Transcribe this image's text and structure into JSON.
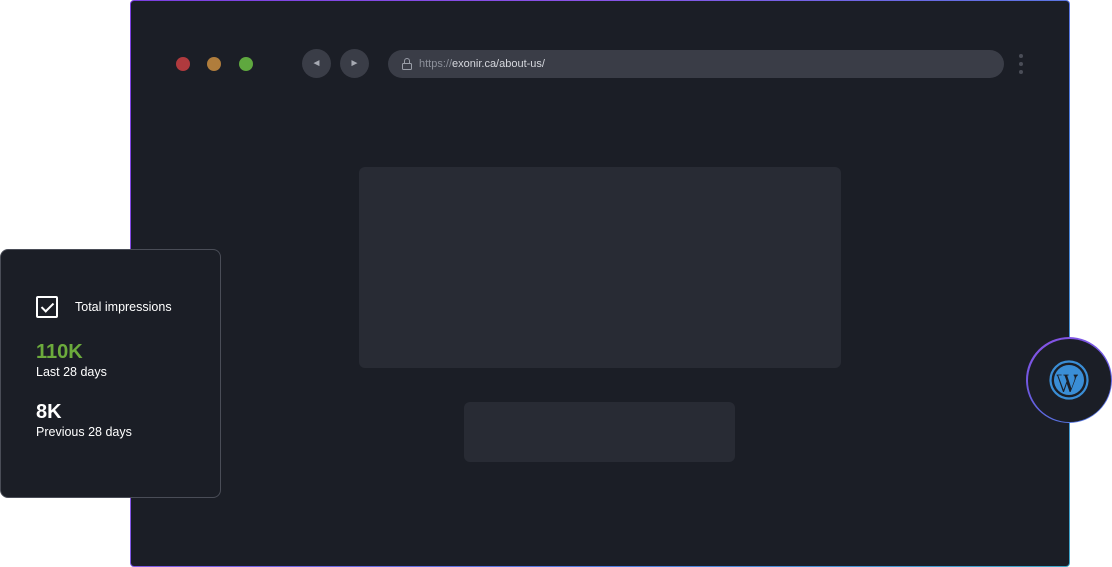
{
  "browser": {
    "window_controls": [
      "close",
      "minimize",
      "maximize"
    ],
    "nav": {
      "back_icon": "back-arrow-icon",
      "back_glyph": "◄",
      "forward_icon": "forward-arrow-icon",
      "forward_glyph": "►"
    },
    "url": {
      "protocol": "https://",
      "host_path": "exonir.ca/about-us/"
    }
  },
  "stats_card": {
    "metric_label": "Total impressions",
    "current": {
      "value": "110K",
      "caption": "Last 28 days"
    },
    "previous": {
      "value": "8K",
      "caption": "Previous 28 days"
    }
  },
  "badge": {
    "icon": "wordpress-icon"
  },
  "colors": {
    "background": "#1b1e26",
    "placeholder": "#282b34",
    "accent_green": "#6cab3c",
    "wordpress_blue": "#3a8ed6",
    "border_gradient_start": "#7b3fe0",
    "border_gradient_end": "#3fa7c9"
  }
}
